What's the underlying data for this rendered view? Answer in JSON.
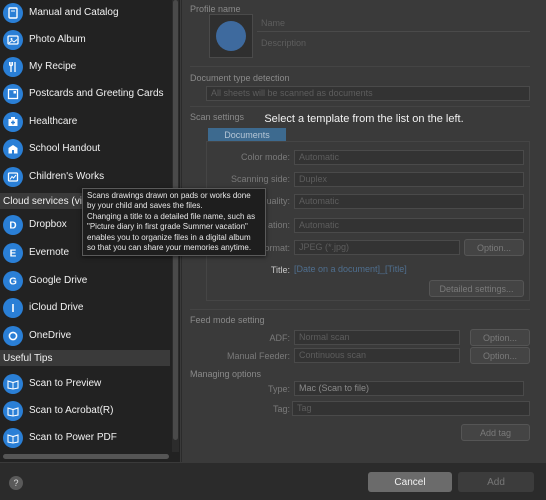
{
  "sidebar": {
    "items_top": [
      {
        "label": "Manual and Catalog",
        "icon": "book-icon"
      },
      {
        "label": "Photo Album",
        "icon": "photo-album-icon"
      },
      {
        "label": "My Recipe",
        "icon": "fork-knife-icon"
      },
      {
        "label": "Postcards and Greeting Cards",
        "icon": "postcard-icon"
      },
      {
        "label": "Healthcare",
        "icon": "healthcare-icon"
      },
      {
        "label": "School Handout",
        "icon": "school-icon"
      },
      {
        "label": "Children's Works",
        "icon": "drawing-icon"
      }
    ],
    "cloud_header": "Cloud services (via",
    "cloud_items": [
      {
        "label": "Dropbox",
        "icon": "dropbox-icon"
      },
      {
        "label": "Evernote",
        "icon": "evernote-icon"
      },
      {
        "label": "Google Drive",
        "icon": "google-drive-icon"
      },
      {
        "label": "iCloud Drive",
        "icon": "icloud-icon"
      },
      {
        "label": "OneDrive",
        "icon": "onedrive-icon"
      }
    ],
    "tips_header": "Useful Tips",
    "tips_items": [
      {
        "label": "Scan to Preview",
        "icon": "open-book-icon"
      },
      {
        "label": "Scan to Acrobat(R)",
        "icon": "open-book-icon"
      },
      {
        "label": "Scan to Power PDF",
        "icon": "open-book-icon"
      }
    ]
  },
  "tooltip": {
    "line1": "Scans drawings drawn on pads or works done by your child and saves the files.",
    "line2": "Changing a title to a detailed file name, such as \"Picture diary in first grade Summer vacation\" enables you to organize files in a digital album so that you can share your memories anytime."
  },
  "main": {
    "message": "Select a template from the list on the left.",
    "profile_name_label": "Profile name",
    "name_placeholder": "Name",
    "description_placeholder": "Description",
    "doc_type_label": "Document type detection",
    "doc_type_value": "All sheets will be scanned as documents",
    "scan_settings_label": "Scan settings",
    "tab_documents": "Documents",
    "color_mode_label": "Color mode:",
    "color_mode_value": "Automatic",
    "scanning_side_label": "Scanning side:",
    "scanning_side_value": "Duplex",
    "quality_label": "uality:",
    "quality_value": "Automatic",
    "orientation_label": "ation:",
    "orientation_value": "Automatic",
    "format_label": "ormat:",
    "format_value": "JPEG (*.jpg)",
    "option_label": "Option...",
    "title_label": "Title:",
    "title_value": "[Date on a document]_[Title]",
    "detailed_settings": "Detailed settings...",
    "feed_mode_label": "Feed mode setting",
    "adf_label": "ADF:",
    "adf_value": "Normal scan",
    "manual_feeder_label": "Manual Feeder:",
    "manual_feeder_value": "Continuous scan",
    "managing_label": "Managing options",
    "type_label": "Type:",
    "type_value": "Mac (Scan to file)",
    "tag_label": "Tag:",
    "tag_placeholder": "Tag",
    "add_tag": "Add tag"
  },
  "bottom": {
    "help": "?",
    "cancel": "Cancel",
    "add": "Add"
  }
}
